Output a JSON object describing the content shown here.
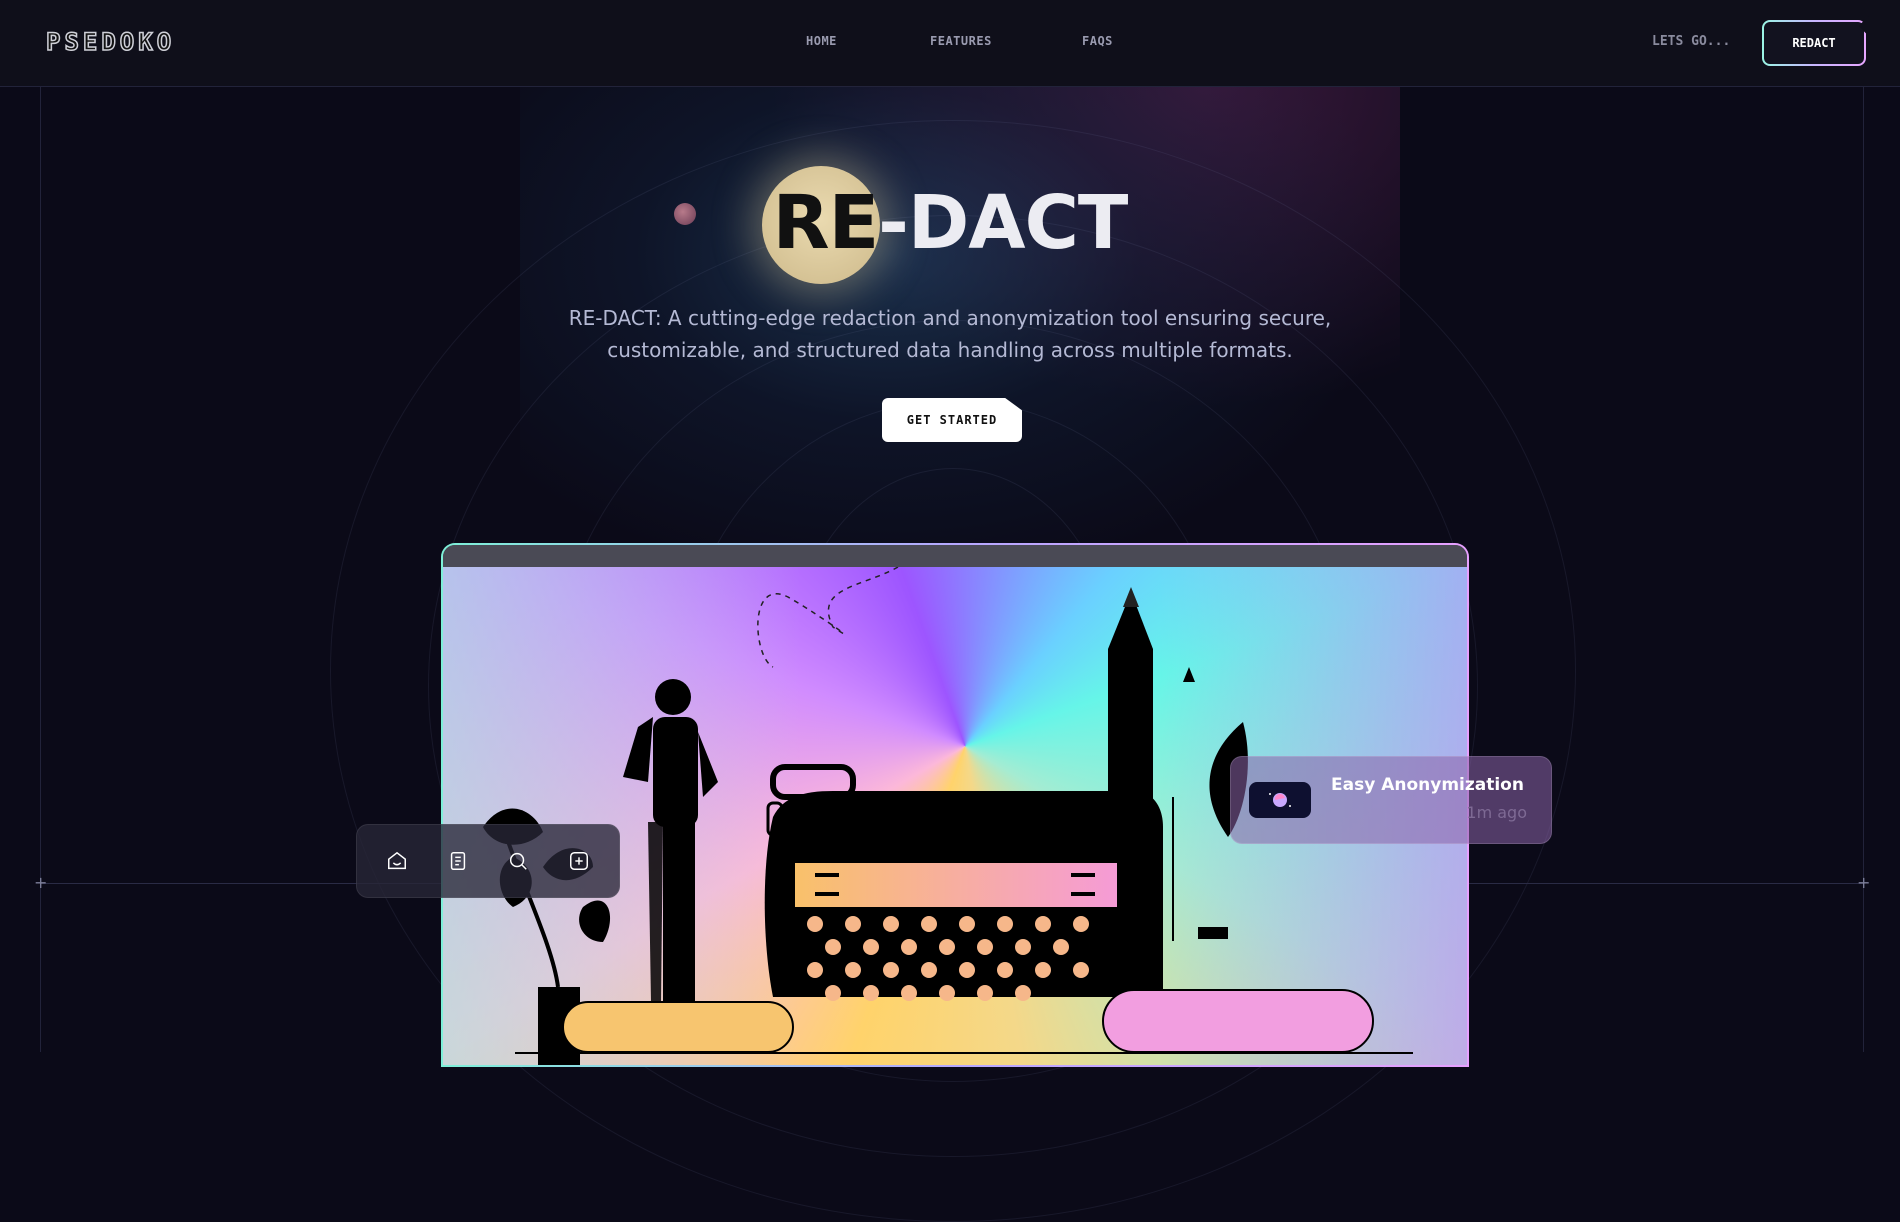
{
  "header": {
    "logo": "PSEDOKO",
    "nav": [
      {
        "label": "HOME"
      },
      {
        "label": "FEATURES"
      },
      {
        "label": "FAQS"
      }
    ],
    "lets_go": "LETS GO...",
    "redact_button": "REDACT"
  },
  "hero": {
    "title_dark": "RE",
    "title_light": "-DACT",
    "subtitle": "RE-DACT: A cutting-edge redaction and anonymization tool ensuring secure, customizable, and structured data handling across multiple formats.",
    "cta": "GET STARTED"
  },
  "toolbar": {
    "icons": [
      "home-icon",
      "document-icon",
      "search-icon",
      "add-icon"
    ]
  },
  "notification": {
    "title": "Easy Anonymization",
    "time": "1m ago"
  },
  "colors": {
    "background": "#0b0a18",
    "header": "#0f0f1a",
    "accent_teal": "#7ef0d8",
    "accent_violet": "#b6a8ff",
    "accent_pink": "#e7a0ff",
    "moon": "#e3d3a6"
  }
}
